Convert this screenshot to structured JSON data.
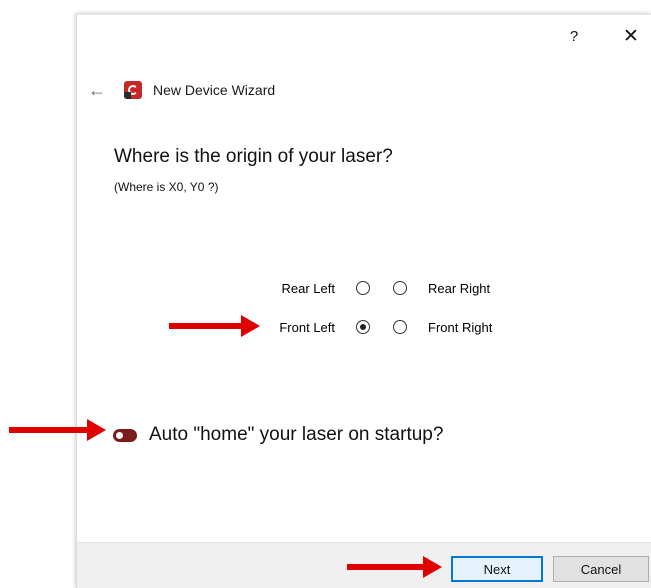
{
  "titlebar": {
    "help_label": "?",
    "close_label": "✕"
  },
  "header": {
    "back_label": "←",
    "title": "New Device Wizard"
  },
  "question": {
    "title": "Where is the origin of your laser?",
    "subtitle": "(Where is X0, Y0 ?)"
  },
  "origin": {
    "rear_left": "Rear Left",
    "rear_right": "Rear Right",
    "front_left": "Front Left",
    "front_right": "Front Right",
    "selected": "Front Left"
  },
  "auto_home": {
    "label": "Auto \"home\" your laser on startup?",
    "enabled": true
  },
  "footer": {
    "next_label": "Next",
    "cancel_label": "Cancel"
  },
  "colors": {
    "annotation_arrow": "#e00000",
    "toggle_on": "#7a1c1c",
    "default_button_border": "#0078d7"
  }
}
